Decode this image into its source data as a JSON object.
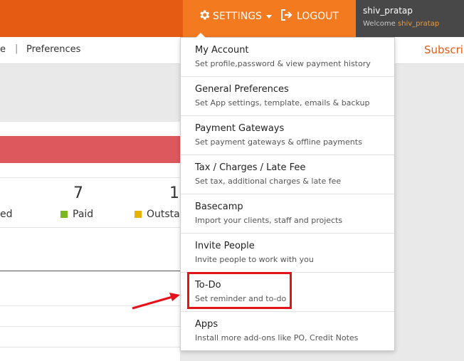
{
  "topbar": {
    "settings_label": "SETTINGS",
    "logout_label": "LOGOUT",
    "user_name": "shiv_pratap",
    "welcome_prefix": "Welcome",
    "welcome_name": "shiv_pratap"
  },
  "breadcrumb": {
    "partial": "e",
    "separator": "|",
    "current": "Preferences"
  },
  "subscribe_partial": "Subscri",
  "stats": [
    {
      "value": "7",
      "label": "Paid",
      "color": "#7bb820"
    },
    {
      "value": "1",
      "label": "Outsta",
      "color": "#e6b400"
    }
  ],
  "stat_partial_label": "ed",
  "menu": [
    {
      "title": "My Account",
      "desc": "Set profile,password & view payment history"
    },
    {
      "title": "General Preferences",
      "desc": "Set App settings, template, emails & backup"
    },
    {
      "title": "Payment Gateways",
      "desc": "Set payment gateways & offline payments"
    },
    {
      "title": "Tax / Charges / Late Fee",
      "desc": "Set tax, additional charges & late fee"
    },
    {
      "title": "Basecamp",
      "desc": "Import your clients, staff and projects"
    },
    {
      "title": "Invite People",
      "desc": "Invite people to work with you"
    },
    {
      "title": "To-Do",
      "desc": "Set reminder and to-do"
    },
    {
      "title": "Apps",
      "desc": "Install more add-ons like PO, Credit Notes"
    }
  ],
  "colors": {
    "brand_orange": "#e65b13",
    "settings_orange": "#f47a1f",
    "highlight_red": "#e4121a",
    "red_band": "#dd585d"
  },
  "icons": [
    "gear-icon",
    "logout-icon",
    "caret-down-icon",
    "annotation-arrow"
  ]
}
